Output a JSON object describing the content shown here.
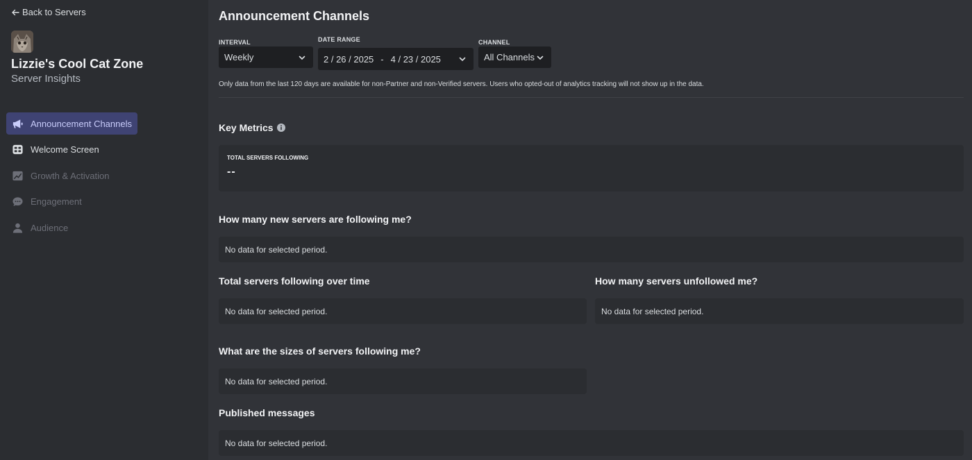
{
  "sidebar": {
    "back_label": "Back to Servers",
    "server_name": "Lizzie's Cool Cat Zone",
    "server_subtitle": "Server Insights",
    "items": [
      {
        "label": "Announcement Channels",
        "icon": "megaphone-icon",
        "state": "active"
      },
      {
        "label": "Welcome Screen",
        "icon": "welcome-screen-icon",
        "state": "normal"
      },
      {
        "label": "Growth & Activation",
        "icon": "growth-chart-icon",
        "state": "disabled"
      },
      {
        "label": "Engagement",
        "icon": "chat-bubble-icon",
        "state": "disabled"
      },
      {
        "label": "Audience",
        "icon": "person-icon",
        "state": "disabled"
      }
    ]
  },
  "main": {
    "title": "Announcement Channels",
    "filters": {
      "interval_label": "INTERVAL",
      "interval_value": "Weekly",
      "date_range_label": "DATE RANGE",
      "date_start": "2 / 26 / 2025",
      "date_separator": "-",
      "date_end": "4 / 23 / 2025",
      "channel_label": "CHANNEL",
      "channel_value": "All Channels"
    },
    "notice": "Only data from the last 120 days are available for non-Partner and non-Verified servers. Users who opted-out of analytics tracking will not show up in the data.",
    "key_metrics": {
      "title": "Key Metrics",
      "metric_label": "TOTAL SERVERS FOLLOWING",
      "metric_value": "--"
    },
    "sections": {
      "new_followers": {
        "title": "How many new servers are following me?",
        "empty": "No data for selected period."
      },
      "total_over_time": {
        "title": "Total servers following over time",
        "empty": "No data for selected period."
      },
      "unfollowed": {
        "title": "How many servers unfollowed me?",
        "empty": "No data for selected period."
      },
      "sizes": {
        "title": "What are the sizes of servers following me?",
        "empty": "No data for selected period."
      },
      "published": {
        "title": "Published messages",
        "empty": "No data for selected period."
      }
    }
  }
}
